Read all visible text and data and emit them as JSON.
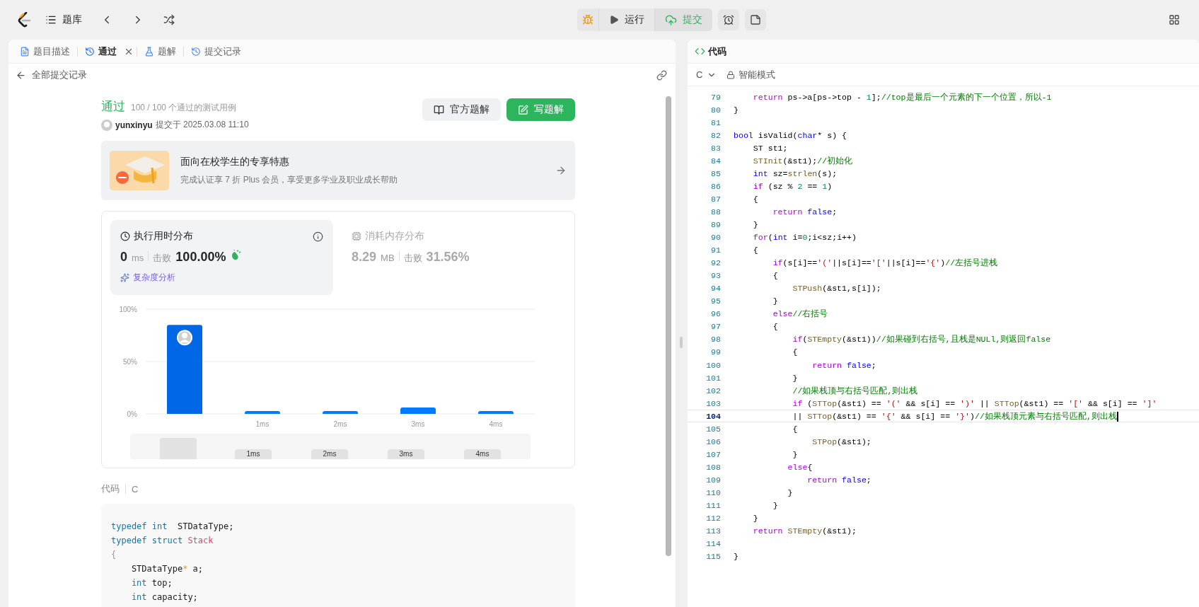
{
  "topbar": {
    "problem_bank": "题库",
    "run": "运行",
    "submit": "提交"
  },
  "left_tabs": [
    {
      "label": "题目描述",
      "kind": "description",
      "selected": false,
      "closable": false
    },
    {
      "label": "通过",
      "kind": "result",
      "selected": true,
      "closable": true
    },
    {
      "label": "题解",
      "kind": "solution",
      "selected": false,
      "closable": false
    },
    {
      "label": "提交记录",
      "kind": "history",
      "selected": false,
      "closable": false
    }
  ],
  "back_link": "全部提交记录",
  "result": {
    "status": "通过",
    "detail": "100 / 100 个通过的测试用例",
    "user": "yunxinyu",
    "submitted": "提交于 2025.03.08 11:10"
  },
  "actions": [
    {
      "label": "官方题解",
      "kind": "secondary"
    },
    {
      "label": "写题解",
      "kind": "primary"
    }
  ],
  "promo": {
    "title": "面向在校学生的专享特惠",
    "subtitle": "完成认证享 7 折 Plus 会员，享受更多学业及职业成长帮助"
  },
  "stats": [
    {
      "kind": "runtime",
      "title": "执行用时分布",
      "value": "0",
      "unit": "ms",
      "beats_label": "击败",
      "beats": "100.00%",
      "link": "复杂度分析",
      "selected": true
    },
    {
      "kind": "memory",
      "title": "消耗内存分布",
      "value": "8.29",
      "unit": "MB",
      "beats_label": "击败",
      "beats": "31.56%",
      "selected": false
    }
  ],
  "chart_data": {
    "type": "bar",
    "categories": [
      null,
      "1ms",
      "2ms",
      "3ms",
      "4ms"
    ],
    "values": [
      85,
      2,
      2,
      6,
      2
    ],
    "ylim": [
      0,
      100
    ],
    "yticks": [
      {
        "value": 0,
        "label": "0%"
      },
      {
        "value": 50,
        "label": "50%"
      },
      {
        "value": 100,
        "label": "100%"
      }
    ]
  },
  "navigator_labels": [
    "1ms",
    "2ms",
    "3ms",
    "4ms"
  ],
  "code_section": {
    "label": "代码",
    "language": "C",
    "lines": [
      {
        "tokens": [
          {
            "kind": "type",
            "text": "typedef"
          },
          {
            "kind": "type",
            "text": " int"
          },
          {
            "kind": "pl",
            "text": "  STDataType;"
          }
        ]
      },
      {
        "tokens": [
          {
            "kind": "type",
            "text": "typedef"
          },
          {
            "kind": "type",
            "text": " struct"
          },
          {
            "kind": "cls",
            "text": " Stack"
          }
        ]
      },
      {
        "tokens": [
          {
            "kind": "pun",
            "text": "{"
          }
        ]
      },
      {
        "tokens": [
          {
            "kind": "pl",
            "text": "    STDataType"
          },
          {
            "kind": "op",
            "text": "*"
          },
          {
            "kind": "pl",
            "text": " a;"
          }
        ]
      },
      {
        "tokens": [
          {
            "kind": "type",
            "text": "    int"
          },
          {
            "kind": "pl",
            "text": " top;"
          }
        ]
      },
      {
        "tokens": [
          {
            "kind": "type",
            "text": "    int"
          },
          {
            "kind": "pl",
            "text": " capacity;"
          }
        ]
      }
    ]
  },
  "editor": {
    "title": "代码",
    "language": "C",
    "mode": "智能模式",
    "lines": [
      {
        "num": "79",
        "current": false,
        "tokens": [
          {
            "kind": "kw",
            "text": "    return"
          },
          {
            "kind": "pl",
            "text": " ps->a[ps->top - "
          },
          {
            "kind": "num",
            "text": "1"
          },
          {
            "kind": "pl",
            "text": "];"
          },
          {
            "kind": "cm",
            "text": "//top是最后一个元素的下一个位置，所以-1"
          }
        ]
      },
      {
        "num": "80",
        "current": false,
        "tokens": [
          {
            "kind": "pl",
            "text": "}"
          }
        ]
      },
      {
        "num": "81",
        "current": false
      },
      {
        "num": "82",
        "current": false,
        "tokens": [
          {
            "kind": "type",
            "text": "bool"
          },
          {
            "kind": "pl",
            "text": " isValid("
          },
          {
            "kind": "type",
            "text": "char"
          },
          {
            "kind": "pl",
            "text": "* s) {"
          }
        ]
      },
      {
        "num": "83",
        "current": false,
        "tokens": [
          {
            "kind": "pl",
            "text": "    ST st1;"
          }
        ]
      },
      {
        "num": "84",
        "current": false,
        "tokens": [
          {
            "kind": "fn",
            "text": "    STInit"
          },
          {
            "kind": "pl",
            "text": "(&st1);"
          },
          {
            "kind": "cm",
            "text": "//初始化"
          }
        ]
      },
      {
        "num": "85",
        "current": false,
        "tokens": [
          {
            "kind": "type",
            "text": "    int"
          },
          {
            "kind": "pl",
            "text": " sz="
          },
          {
            "kind": "fn",
            "text": "strlen"
          },
          {
            "kind": "pl",
            "text": "(s);"
          }
        ]
      },
      {
        "num": "86",
        "current": false,
        "tokens": [
          {
            "kind": "kw",
            "text": "    if"
          },
          {
            "kind": "pl",
            "text": " (sz % "
          },
          {
            "kind": "num",
            "text": "2"
          },
          {
            "kind": "pl",
            "text": " == "
          },
          {
            "kind": "num",
            "text": "1"
          },
          {
            "kind": "pl",
            "text": ")"
          }
        ]
      },
      {
        "num": "87",
        "current": false,
        "tokens": [
          {
            "kind": "pl",
            "text": "    {"
          }
        ]
      },
      {
        "num": "88",
        "current": false,
        "tokens": [
          {
            "kind": "kw",
            "text": "        return"
          },
          {
            "kind": "type",
            "text": " false"
          },
          {
            "kind": "pl",
            "text": ";"
          }
        ]
      },
      {
        "num": "89",
        "current": false,
        "tokens": [
          {
            "kind": "pl",
            "text": "    }"
          }
        ]
      },
      {
        "num": "90",
        "current": false,
        "tokens": [
          {
            "kind": "kw",
            "text": "    for"
          },
          {
            "kind": "pl",
            "text": "("
          },
          {
            "kind": "type",
            "text": "int"
          },
          {
            "kind": "pl",
            "text": " i="
          },
          {
            "kind": "num",
            "text": "0"
          },
          {
            "kind": "pl",
            "text": ";i<sz;i++)"
          }
        ]
      },
      {
        "num": "91",
        "current": false,
        "tokens": [
          {
            "kind": "pl",
            "text": "    {"
          }
        ]
      },
      {
        "num": "92",
        "current": false,
        "tokens": [
          {
            "kind": "kw",
            "text": "        if"
          },
          {
            "kind": "pl",
            "text": "(s[i]=="
          },
          {
            "kind": "str",
            "text": "'('"
          },
          {
            "kind": "pl",
            "text": "||s[i]=="
          },
          {
            "kind": "str",
            "text": "'['"
          },
          {
            "kind": "pl",
            "text": "||s[i]=="
          },
          {
            "kind": "str",
            "text": "'{'"
          },
          {
            "kind": "pl",
            "text": ")"
          },
          {
            "kind": "cm",
            "text": "//左括号进栈"
          }
        ]
      },
      {
        "num": "93",
        "current": false,
        "tokens": [
          {
            "kind": "pl",
            "text": "        {"
          }
        ]
      },
      {
        "num": "94",
        "current": false,
        "tokens": [
          {
            "kind": "fn",
            "text": "            STPush"
          },
          {
            "kind": "pl",
            "text": "(&st1,s[i]);"
          }
        ]
      },
      {
        "num": "95",
        "current": false,
        "tokens": [
          {
            "kind": "pl",
            "text": "        }"
          }
        ]
      },
      {
        "num": "96",
        "current": false,
        "tokens": [
          {
            "kind": "kw",
            "text": "        else"
          },
          {
            "kind": "cm",
            "text": "//右括号"
          }
        ]
      },
      {
        "num": "97",
        "current": false,
        "tokens": [
          {
            "kind": "pl",
            "text": "        {"
          }
        ]
      },
      {
        "num": "98",
        "current": false,
        "tokens": [
          {
            "kind": "kw",
            "text": "            if"
          },
          {
            "kind": "pl",
            "text": "("
          },
          {
            "kind": "fn",
            "text": "STEmpty"
          },
          {
            "kind": "pl",
            "text": "(&st1))"
          },
          {
            "kind": "cm",
            "text": "//如果碰到右括号,且栈是NULl,则返回false"
          }
        ]
      },
      {
        "num": "99",
        "current": false,
        "tokens": [
          {
            "kind": "pl",
            "text": "            {"
          }
        ]
      },
      {
        "num": "100",
        "current": false,
        "tokens": [
          {
            "kind": "kw",
            "text": "                return"
          },
          {
            "kind": "type",
            "text": " false"
          },
          {
            "kind": "pl",
            "text": ";"
          }
        ]
      },
      {
        "num": "101",
        "current": false,
        "tokens": [
          {
            "kind": "pl",
            "text": "            }"
          }
        ]
      },
      {
        "num": "102",
        "current": false,
        "tokens": [
          {
            "kind": "cm",
            "text": "            //如果栈顶与右括号匹配,则出栈"
          }
        ]
      },
      {
        "num": "103",
        "current": false,
        "tokens": [
          {
            "kind": "kw",
            "text": "            if"
          },
          {
            "kind": "pl",
            "text": " ("
          },
          {
            "kind": "fn",
            "text": "STTop"
          },
          {
            "kind": "pl",
            "text": "(&st1) == "
          },
          {
            "kind": "str",
            "text": "'('"
          },
          {
            "kind": "pl",
            "text": " && s[i] == "
          },
          {
            "kind": "str",
            "text": "')'"
          },
          {
            "kind": "pl",
            "text": " || "
          },
          {
            "kind": "fn",
            "text": "STTop"
          },
          {
            "kind": "pl",
            "text": "(&st1) == "
          },
          {
            "kind": "str",
            "text": "'['"
          },
          {
            "kind": "pl",
            "text": " && s[i] == "
          },
          {
            "kind": "str",
            "text": "']'"
          }
        ]
      },
      {
        "num": "104",
        "current": true,
        "tokens": [
          {
            "kind": "pl",
            "text": "            || "
          },
          {
            "kind": "fn",
            "text": "STTop"
          },
          {
            "kind": "pl",
            "text": "(&st1) == "
          },
          {
            "kind": "str",
            "text": "'{'"
          },
          {
            "kind": "pl",
            "text": " && s[i] == "
          },
          {
            "kind": "str",
            "text": "'}'"
          },
          {
            "kind": "pl",
            "text": ")"
          },
          {
            "kind": "cm",
            "text": "//如果栈顶元素与右括号匹配,则出栈"
          }
        ]
      },
      {
        "num": "105",
        "current": false,
        "tokens": [
          {
            "kind": "pl",
            "text": "            {"
          }
        ]
      },
      {
        "num": "106",
        "current": false,
        "tokens": [
          {
            "kind": "fn",
            "text": "                STPop"
          },
          {
            "kind": "pl",
            "text": "(&st1);"
          }
        ]
      },
      {
        "num": "107",
        "current": false,
        "tokens": [
          {
            "kind": "pl",
            "text": "            }"
          }
        ]
      },
      {
        "num": "108",
        "current": false,
        "tokens": [
          {
            "kind": "kw",
            "text": "           else"
          },
          {
            "kind": "pl",
            "text": "{"
          }
        ]
      },
      {
        "num": "109",
        "current": false,
        "tokens": [
          {
            "kind": "kw",
            "text": "               return"
          },
          {
            "kind": "type",
            "text": " false"
          },
          {
            "kind": "pl",
            "text": ";"
          }
        ]
      },
      {
        "num": "110",
        "current": false,
        "tokens": [
          {
            "kind": "pl",
            "text": "           }"
          }
        ]
      },
      {
        "num": "111",
        "current": false,
        "tokens": [
          {
            "kind": "pl",
            "text": "        }"
          }
        ]
      },
      {
        "num": "112",
        "current": false,
        "tokens": [
          {
            "kind": "pl",
            "text": "    }"
          }
        ]
      },
      {
        "num": "113",
        "current": false,
        "tokens": [
          {
            "kind": "kw",
            "text": "    return"
          },
          {
            "kind": "fn",
            "text": " STEmpty"
          },
          {
            "kind": "pl",
            "text": "(&st1);"
          }
        ]
      },
      {
        "num": "114",
        "current": false
      },
      {
        "num": "115",
        "current": false,
        "tokens": [
          {
            "kind": "pl",
            "text": "}"
          }
        ]
      }
    ]
  }
}
